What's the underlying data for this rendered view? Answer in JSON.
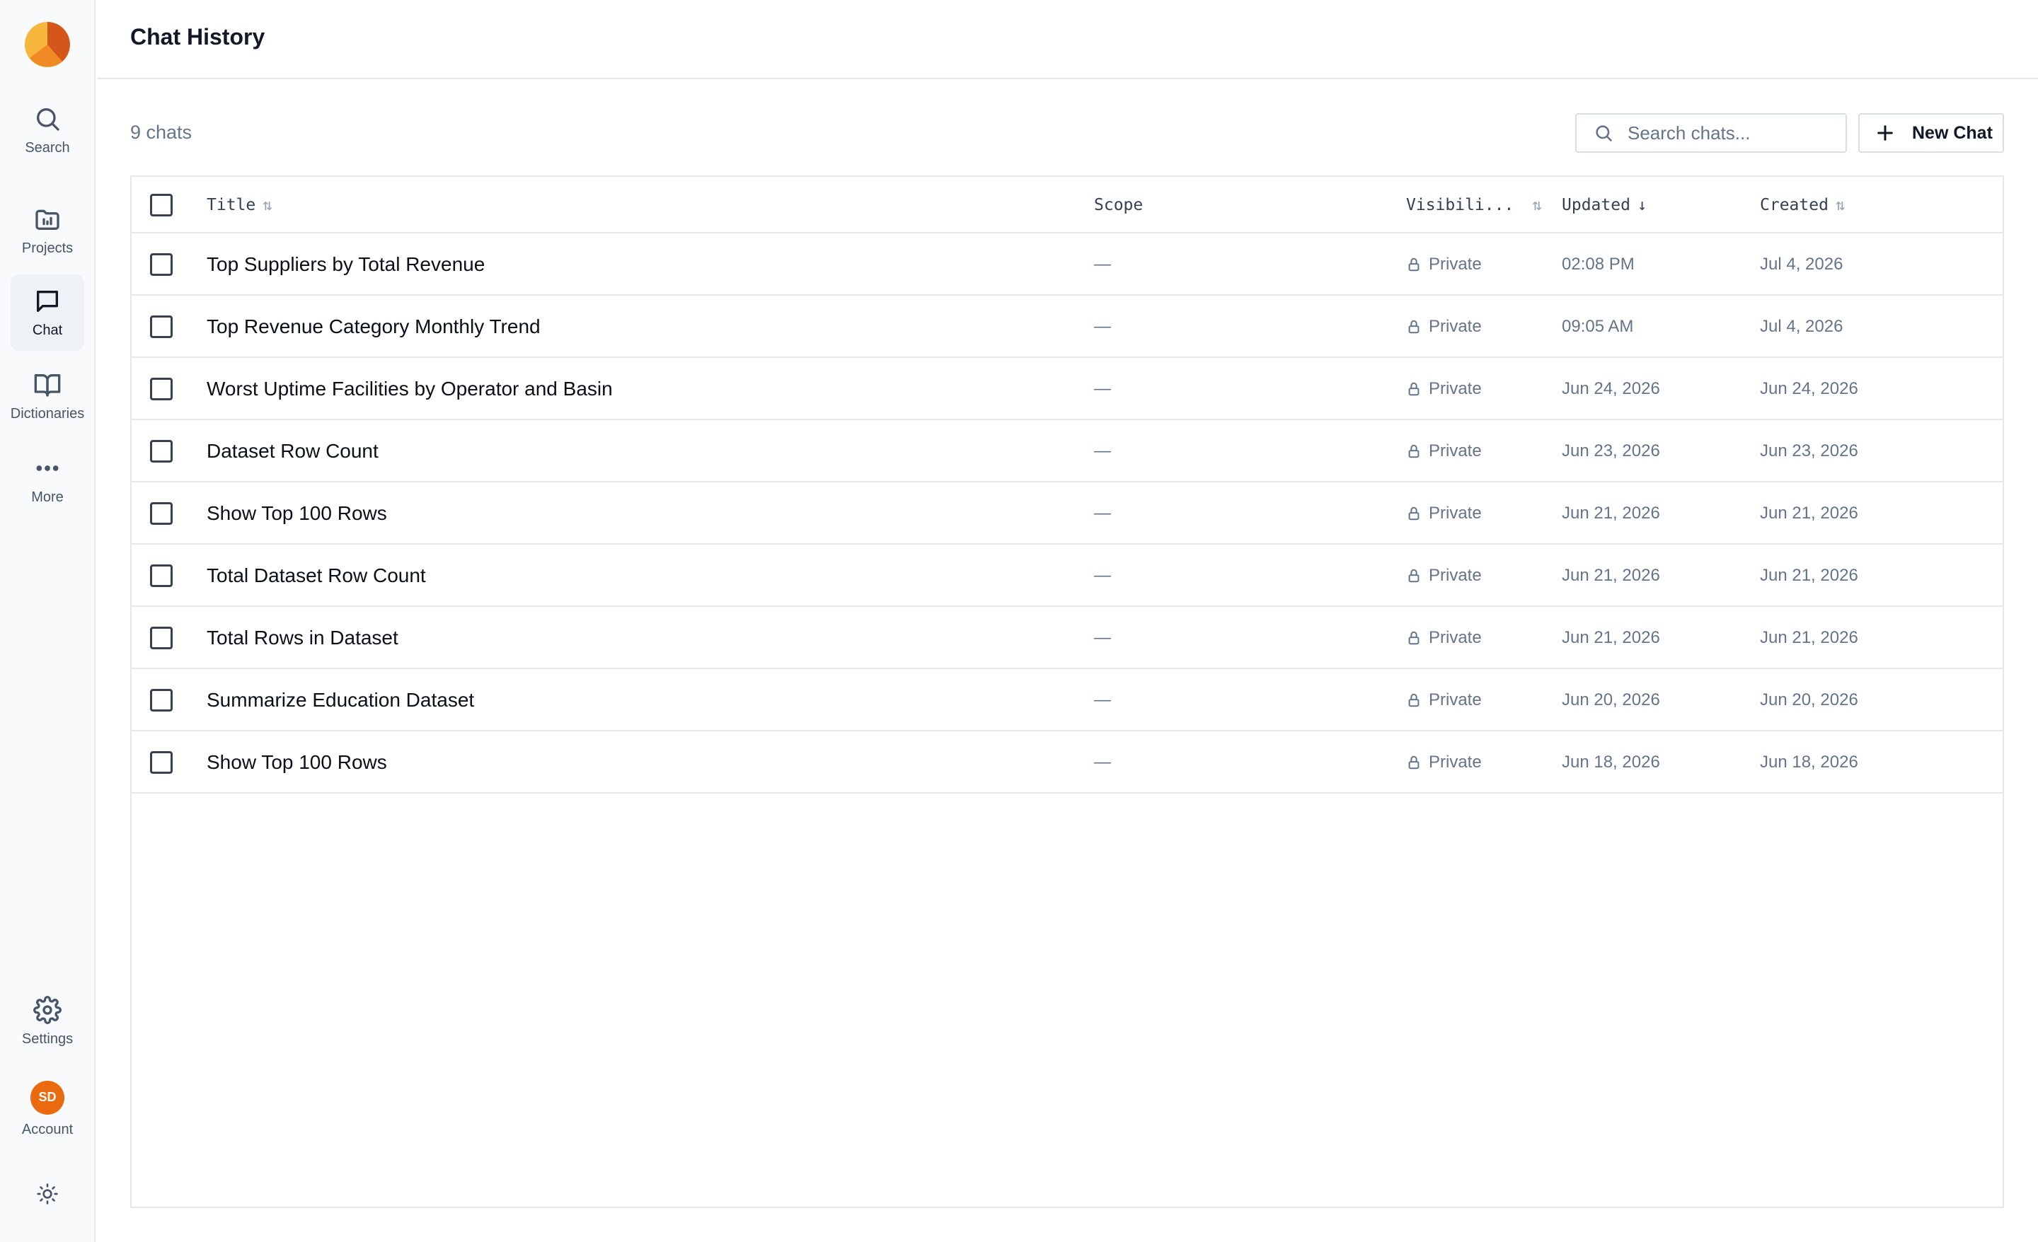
{
  "sidebar": {
    "items": [
      {
        "label": "Search",
        "icon": "search-icon"
      },
      {
        "label": "Projects",
        "icon": "folder-icon"
      },
      {
        "label": "Chat",
        "icon": "chat-icon",
        "active": true
      },
      {
        "label": "Dictionaries",
        "icon": "book-icon"
      },
      {
        "label": "More",
        "icon": "more-icon"
      }
    ],
    "settings_label": "Settings",
    "account_label": "Account",
    "account_initials": "SD",
    "theme_icon": "sun-icon"
  },
  "header": {
    "title": "Chat History"
  },
  "toolbar": {
    "count": "9 chats",
    "search_placeholder": "Search chats...",
    "new_chat_label": "New Chat"
  },
  "table": {
    "columns": {
      "title": "Title",
      "scope": "Scope",
      "visibility": "Visibili...",
      "updated": "Updated",
      "created": "Created"
    },
    "sort": {
      "column": "updated",
      "direction": "desc"
    },
    "rows": [
      {
        "title": "Top Suppliers by Total Revenue",
        "scope": "—",
        "visibility": "Private",
        "updated": "02:08 PM",
        "created": "Jul 4, 2026"
      },
      {
        "title": "Top Revenue Category Monthly Trend",
        "scope": "—",
        "visibility": "Private",
        "updated": "09:05 AM",
        "created": "Jul 4, 2026"
      },
      {
        "title": "Worst Uptime Facilities by Operator and Basin",
        "scope": "—",
        "visibility": "Private",
        "updated": "Jun 24, 2026",
        "created": "Jun 24, 2026"
      },
      {
        "title": "Dataset Row Count",
        "scope": "—",
        "visibility": "Private",
        "updated": "Jun 23, 2026",
        "created": "Jun 23, 2026"
      },
      {
        "title": "Show Top 100 Rows",
        "scope": "—",
        "visibility": "Private",
        "updated": "Jun 21, 2026",
        "created": "Jun 21, 2026"
      },
      {
        "title": "Total Dataset Row Count",
        "scope": "—",
        "visibility": "Private",
        "updated": "Jun 21, 2026",
        "created": "Jun 21, 2026"
      },
      {
        "title": "Total Rows in Dataset",
        "scope": "—",
        "visibility": "Private",
        "updated": "Jun 21, 2026",
        "created": "Jun 21, 2026"
      },
      {
        "title": "Summarize Education Dataset",
        "scope": "—",
        "visibility": "Private",
        "updated": "Jun 20, 2026",
        "created": "Jun 20, 2026"
      },
      {
        "title": "Show Top 100 Rows",
        "scope": "—",
        "visibility": "Private",
        "updated": "Jun 18, 2026",
        "created": "Jun 18, 2026"
      }
    ]
  },
  "colors": {
    "logo_light": "#f6b73c",
    "logo_mid": "#f08a24",
    "logo_dark": "#d4561a",
    "avatar": "#ea6a0d"
  }
}
